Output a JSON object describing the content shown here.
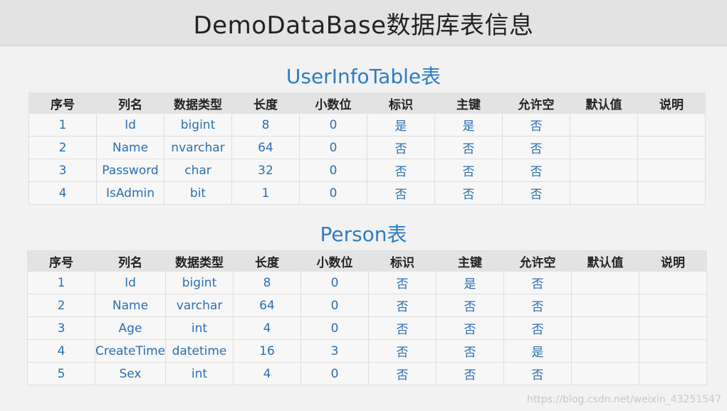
{
  "header": {
    "title": "DemoDataBase数据库表信息"
  },
  "columns": [
    "序号",
    "列名",
    "数据类型",
    "长度",
    "小数位",
    "标识",
    "主键",
    "允许空",
    "默认值",
    "说明"
  ],
  "tables": [
    {
      "title": "UserInfoTable表",
      "rows": [
        [
          "1",
          "Id",
          "bigint",
          "8",
          "0",
          "是",
          "是",
          "否",
          "",
          ""
        ],
        [
          "2",
          "Name",
          "nvarchar",
          "64",
          "0",
          "否",
          "否",
          "否",
          "",
          ""
        ],
        [
          "3",
          "Password",
          "char",
          "32",
          "0",
          "否",
          "否",
          "否",
          "",
          ""
        ],
        [
          "4",
          "IsAdmin",
          "bit",
          "1",
          "0",
          "否",
          "否",
          "否",
          "",
          ""
        ]
      ]
    },
    {
      "title": "Person表",
      "rows": [
        [
          "1",
          "Id",
          "bigint",
          "8",
          "0",
          "否",
          "是",
          "否",
          "",
          ""
        ],
        [
          "2",
          "Name",
          "varchar",
          "64",
          "0",
          "否",
          "否",
          "否",
          "",
          ""
        ],
        [
          "3",
          "Age",
          "int",
          "4",
          "0",
          "否",
          "否",
          "否",
          "",
          ""
        ],
        [
          "4",
          "CreateTime",
          "datetime",
          "16",
          "3",
          "否",
          "否",
          "是",
          "",
          ""
        ],
        [
          "5",
          "Sex",
          "int",
          "4",
          "0",
          "否",
          "否",
          "否",
          "",
          ""
        ]
      ]
    }
  ],
  "watermark": "https://blog.csdn.net/weixin_43251547"
}
